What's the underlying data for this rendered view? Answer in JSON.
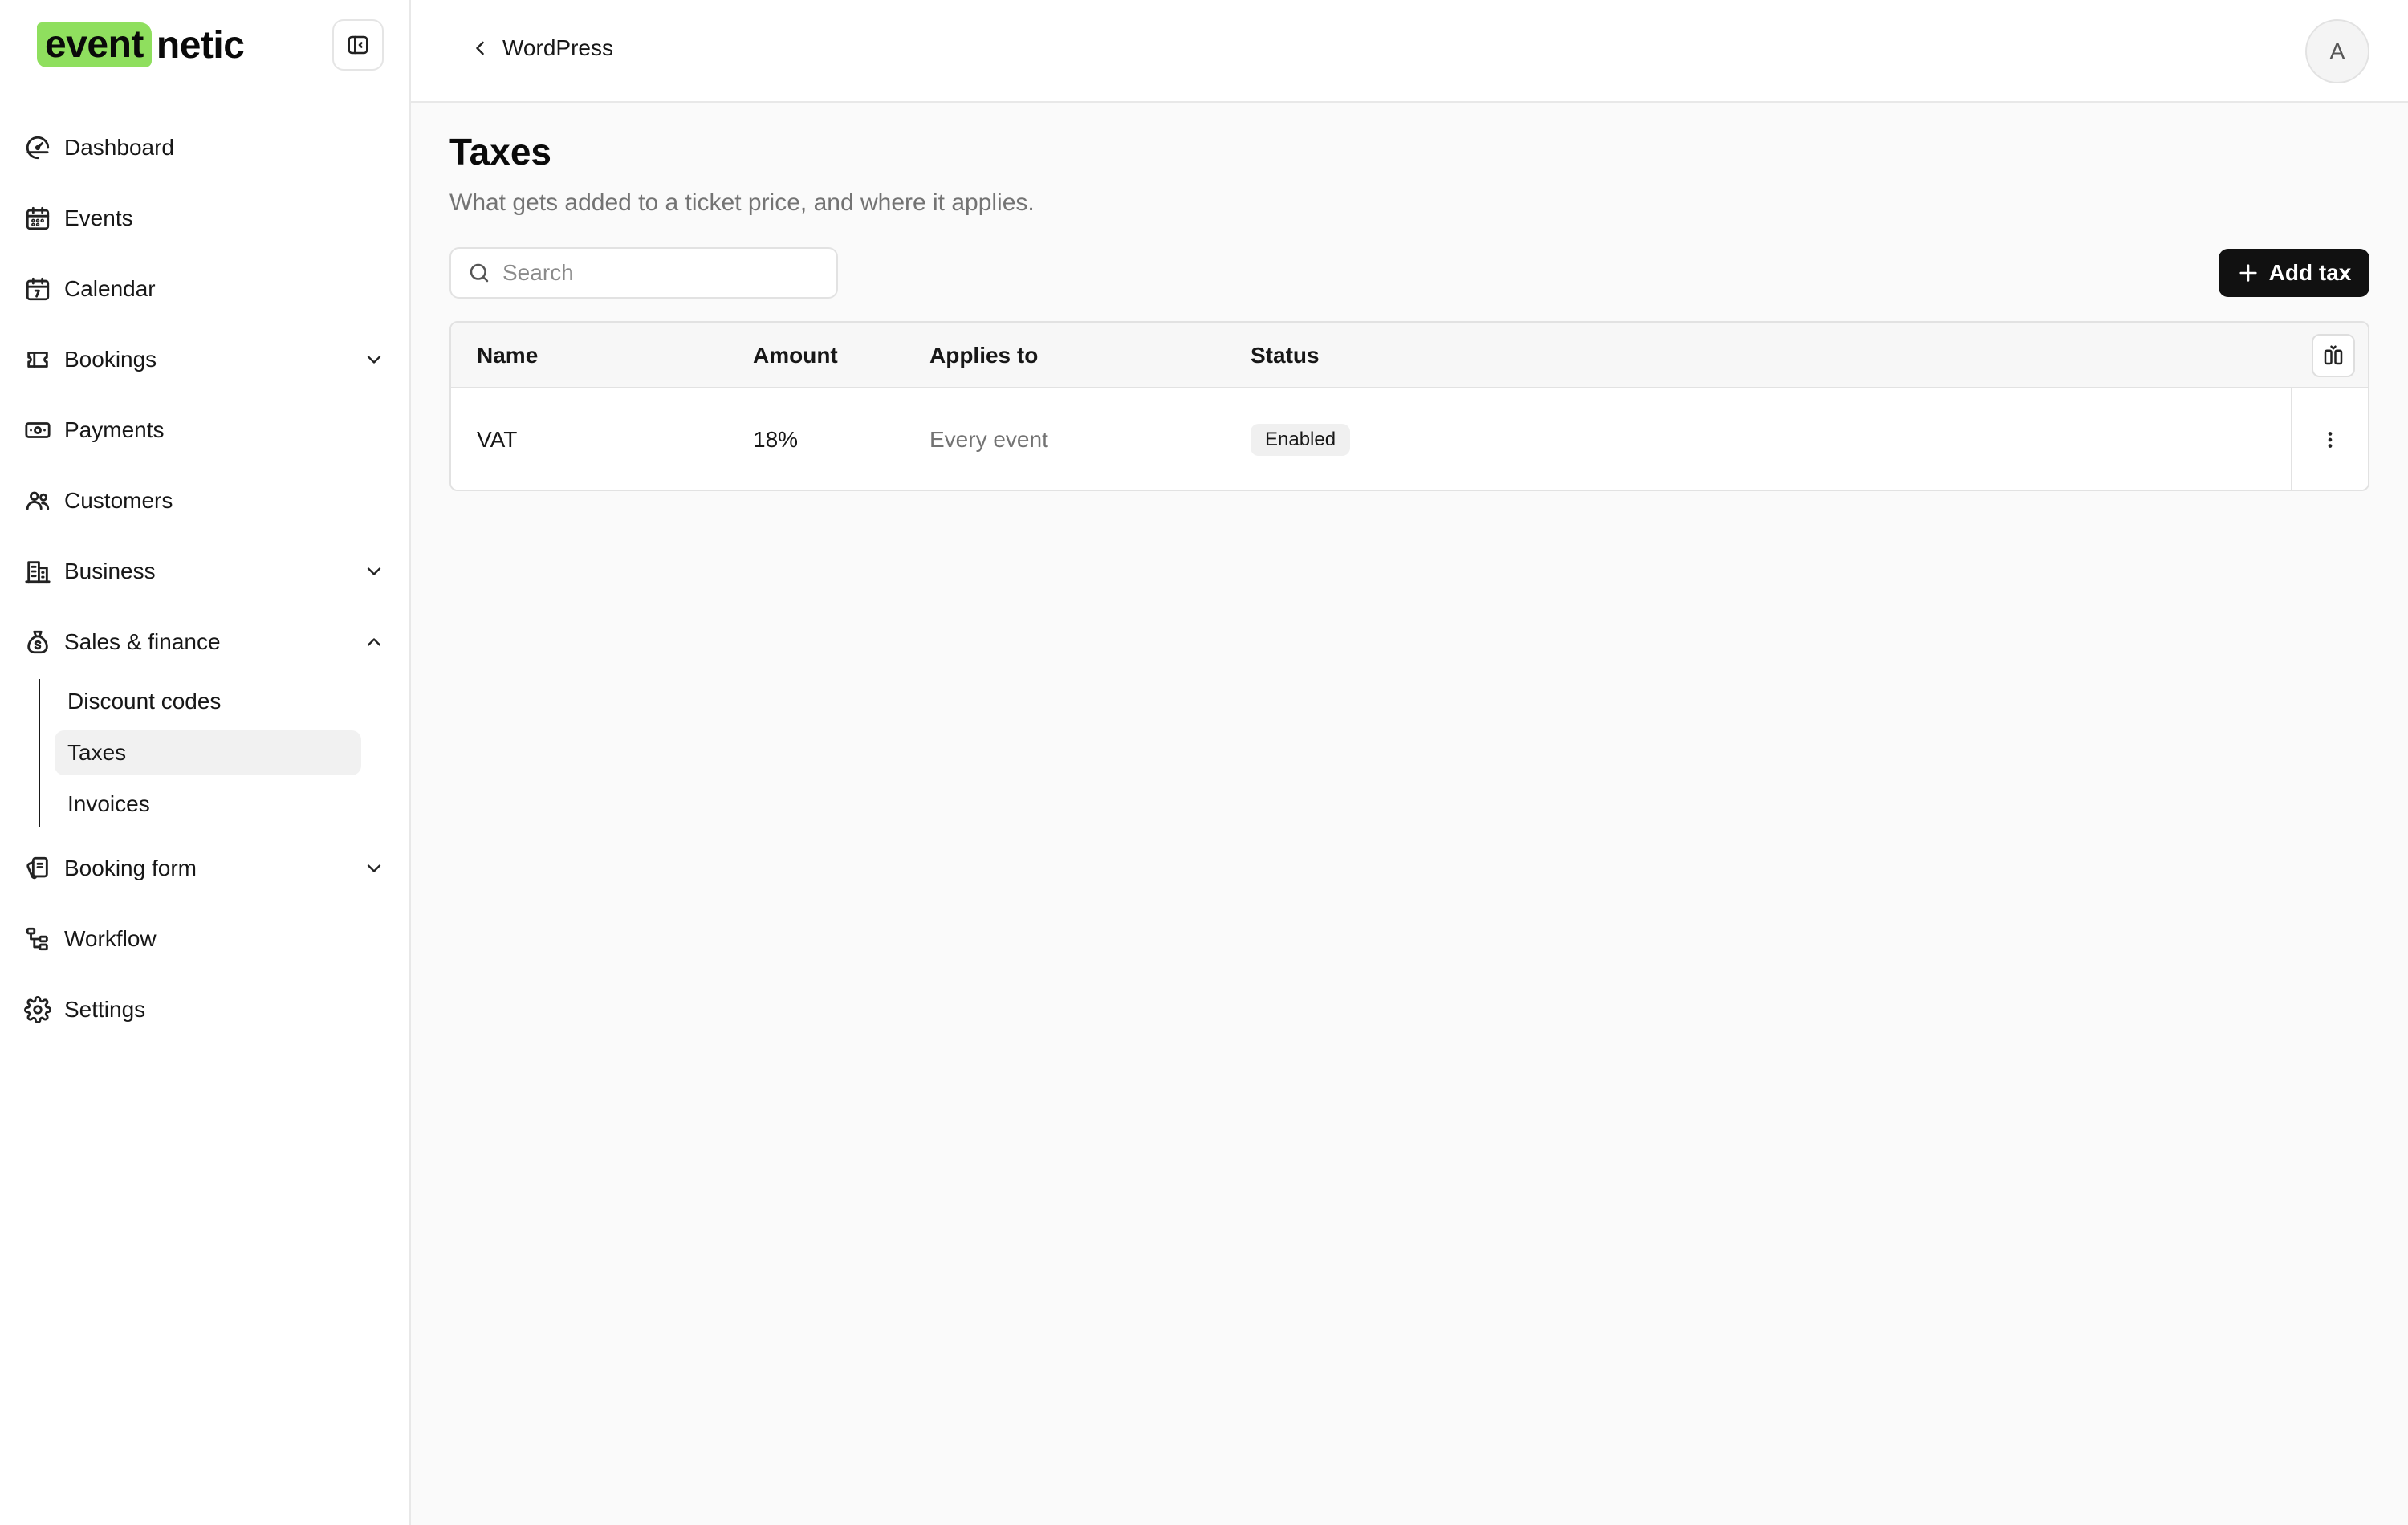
{
  "brand": {
    "mark": "event",
    "word": "netic",
    "accent_color": "#8fdf5e"
  },
  "sidebar": {
    "toggle_icon": "sidebar-toggle-icon",
    "items": [
      {
        "label": "Dashboard",
        "icon": "gauge-icon"
      },
      {
        "label": "Events",
        "icon": "calendar-icon"
      },
      {
        "label": "Calendar",
        "icon": "calendar-date-icon"
      },
      {
        "label": "Bookings",
        "icon": "ticket-icon",
        "expandable": true,
        "expanded": false
      },
      {
        "label": "Payments",
        "icon": "banknote-icon"
      },
      {
        "label": "Customers",
        "icon": "users-icon"
      },
      {
        "label": "Business",
        "icon": "building-icon",
        "expandable": true,
        "expanded": false
      },
      {
        "label": "Sales & finance",
        "icon": "money-bag-icon",
        "expandable": true,
        "expanded": true,
        "children": [
          {
            "label": "Discount codes",
            "active": false
          },
          {
            "label": "Taxes",
            "active": true
          },
          {
            "label": "Invoices",
            "active": false
          }
        ]
      },
      {
        "label": "Booking form",
        "icon": "form-cards-icon",
        "expandable": true,
        "expanded": false
      },
      {
        "label": "Workflow",
        "icon": "workflow-icon"
      },
      {
        "label": "Settings",
        "icon": "gear-icon"
      }
    ]
  },
  "header": {
    "back_label": "WordPress",
    "avatar_initial": "A"
  },
  "main": {
    "title": "Taxes",
    "subtitle": "What gets added to a ticket price, and where it applies.",
    "search": {
      "placeholder": "Search",
      "value": ""
    },
    "add_button_label": "Add tax",
    "table": {
      "columns": [
        "Name",
        "Amount",
        "Applies to",
        "Status"
      ],
      "rows": [
        {
          "name": "VAT",
          "amount": "18%",
          "applies_to": "Every event",
          "status": "Enabled"
        }
      ]
    }
  }
}
